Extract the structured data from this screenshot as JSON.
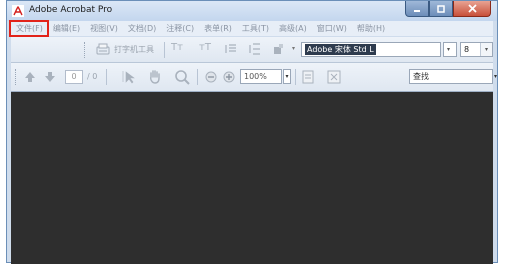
{
  "window": {
    "title": "Adobe Acrobat Pro",
    "app_icon": "acrobat-icon",
    "controls": [
      "minimize-icon",
      "maximize-icon",
      "close-icon"
    ]
  },
  "menu": {
    "items": [
      {
        "label": "文件(F)"
      },
      {
        "label": "编辑(E)"
      },
      {
        "label": "视图(V)"
      },
      {
        "label": "文档(D)"
      },
      {
        "label": "注释(C)"
      },
      {
        "label": "表单(R)"
      },
      {
        "label": "工具(T)"
      },
      {
        "label": "高级(A)"
      },
      {
        "label": "窗口(W)"
      },
      {
        "label": "帮助(H)"
      }
    ],
    "highlighted": "文件(F)",
    "highlight_color": "#e2231a"
  },
  "toolbar1": {
    "typewriter_label": "打字机工具",
    "font_name": "Adobe 宋体 Std L",
    "font_size": "8"
  },
  "toolbar2": {
    "page_current": "0",
    "page_total": "/ 0",
    "zoom": "100%",
    "search_label": "查找"
  },
  "colors": {
    "workspace": "#2e2e2e",
    "frame": "#cfdcec"
  }
}
